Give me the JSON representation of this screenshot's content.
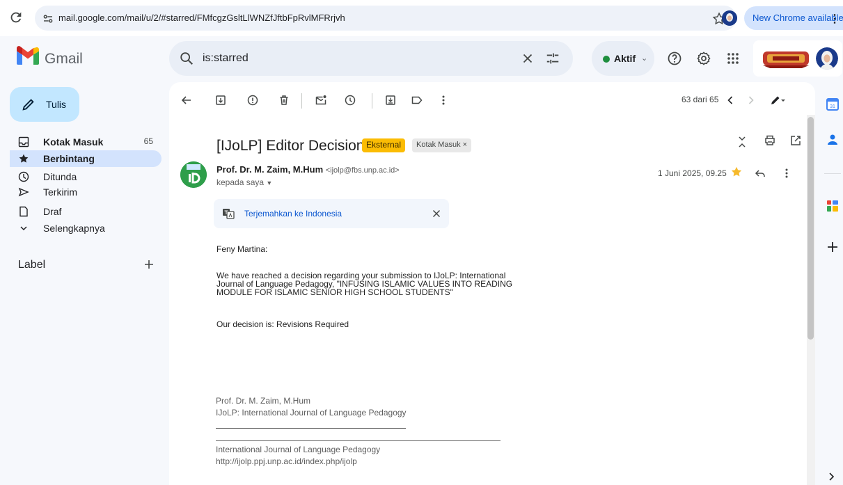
{
  "browser": {
    "url": "mail.google.com/mail/u/2/#starred/FMfcgzGsltLlWNZfJftbFpRvlMFRrjvh",
    "update_label": "New Chrome available"
  },
  "app": {
    "name": "Gmail"
  },
  "search": {
    "query": "is:starred"
  },
  "status": {
    "label": "Aktif"
  },
  "sidebar": {
    "compose_label": "Tulis",
    "items": [
      {
        "label": "Kotak Masuk",
        "count": "65",
        "icon": "inbox-icon"
      },
      {
        "label": "Berbintang",
        "count": "",
        "icon": "star-icon"
      },
      {
        "label": "Ditunda",
        "count": "",
        "icon": "clock-icon"
      },
      {
        "label": "Terkirim",
        "count": "",
        "icon": "send-icon"
      },
      {
        "label": "Draf",
        "count": "",
        "icon": "draft-icon"
      },
      {
        "label": "Selengkapnya",
        "count": "",
        "icon": "chevron-down-icon"
      }
    ],
    "labels_heading": "Label"
  },
  "toolbar": {
    "pager": "63 dari 65"
  },
  "message": {
    "subject": "[IJoLP] Editor Decision",
    "badges": {
      "external": "Eksternal",
      "inbox": "Kotak Masuk ×"
    },
    "sender_name": "Prof. Dr. M. Zaim, M.Hum",
    "sender_email": "<ijolp@fbs.unp.ac.id>",
    "to": "kepada saya",
    "date": "1 Juni 2025, 09.25",
    "translate_label": "Terjemahkan ke Indonesia",
    "body": {
      "greeting": "Feny Martina:",
      "para1_line1": "We have reached a decision regarding your submission to IJoLP: International",
      "para1_line2": "Journal of Language Pedagogy, \"INFUSING ISLAMIC VALUES INTO READING",
      "para1_line3": "MODULE FOR ISLAMIC SENIOR HIGH SCHOOL STUDENTS\"",
      "decision": "Our decision is: Revisions Required"
    },
    "signature": {
      "name": "Prof. Dr. M. Zaim, M.Hum",
      "journal": "IJoLP: International Journal of Language Pedagogy",
      "journal_full": "International Journal of Language Pedagogy",
      "url": "http://ijolp.ppj.unp.ac.id/index.php/ijolp"
    }
  },
  "colors": {
    "compose_bg": "#c2e7ff",
    "active_nav": "#d3e3fd",
    "external_badge": "#fbbc04",
    "link": "#0b57d0"
  }
}
